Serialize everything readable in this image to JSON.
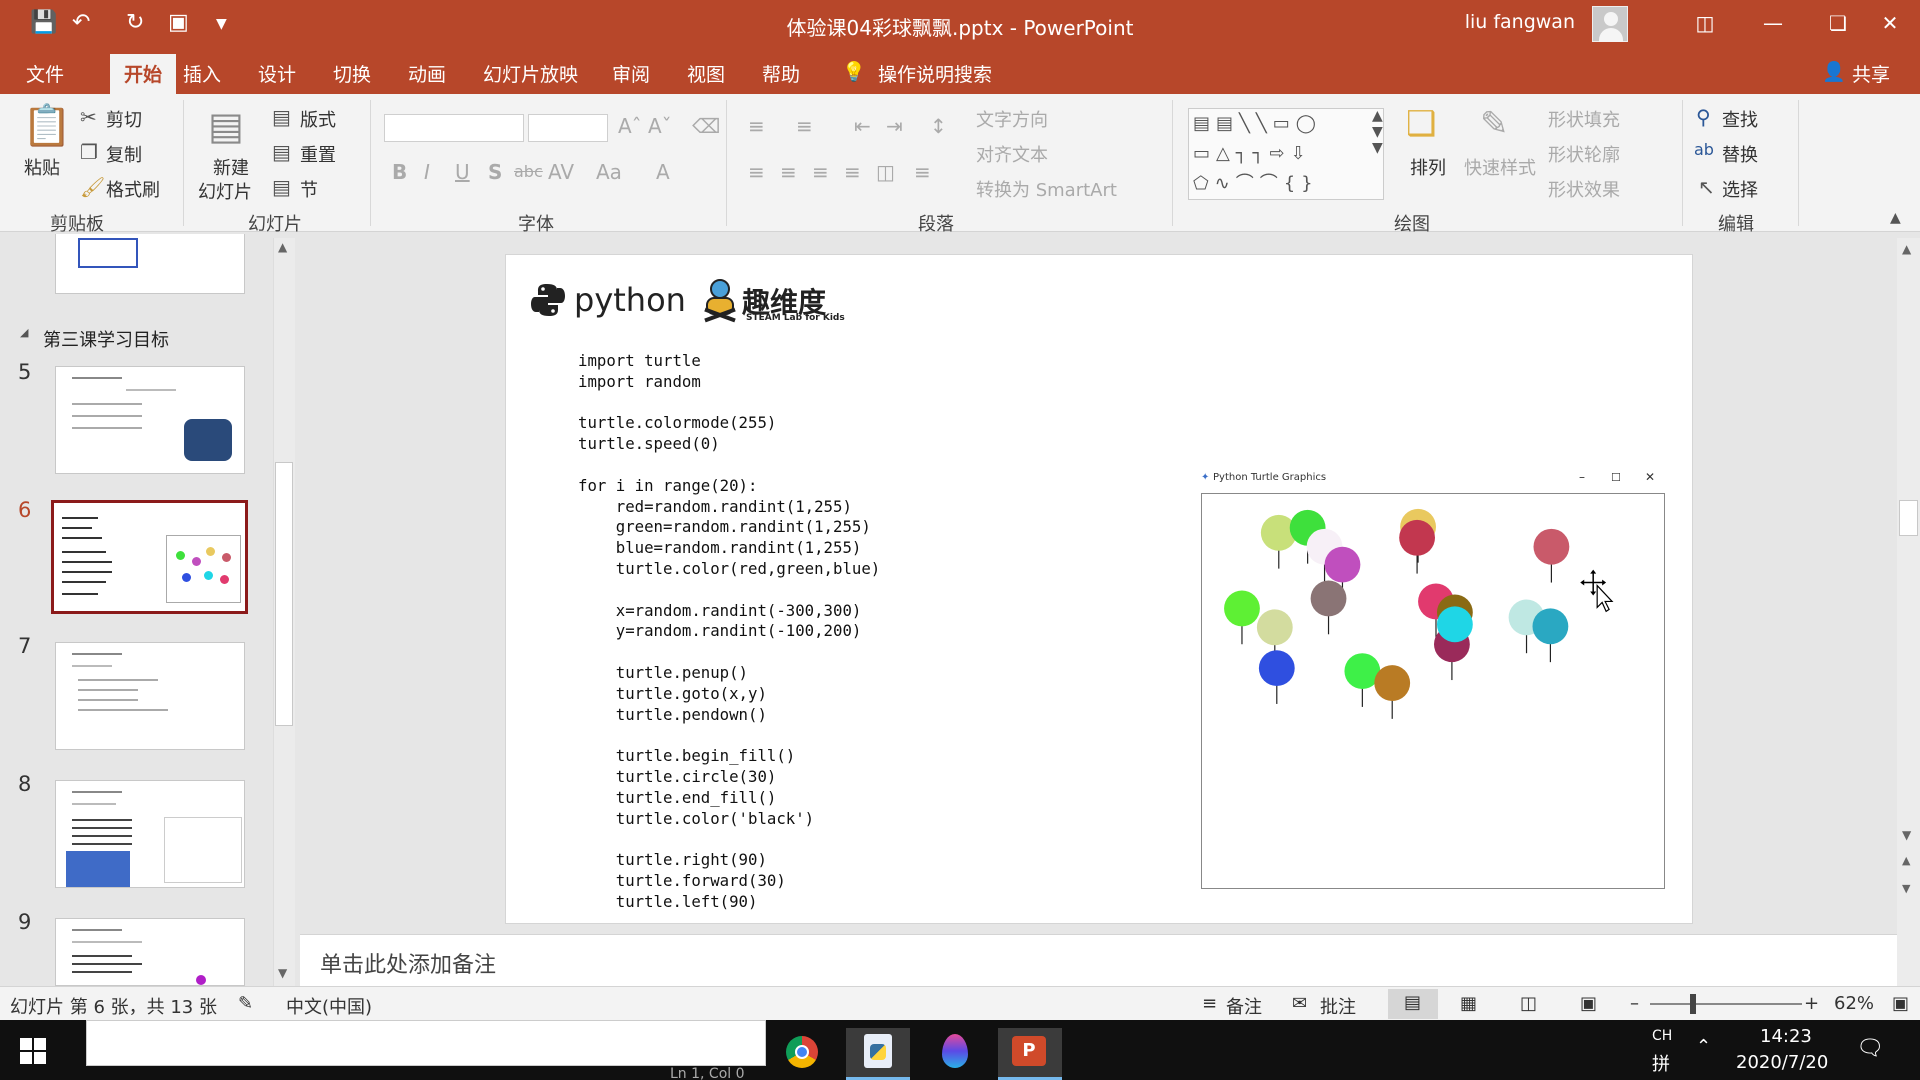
{
  "window": {
    "title": "体验课04彩球飘飘.pptx  -  PowerPoint",
    "user": "liu fangwan"
  },
  "menu": {
    "tabs": [
      "文件",
      "开始",
      "插入",
      "设计",
      "切换",
      "动画",
      "幻灯片放映",
      "审阅",
      "视图",
      "帮助"
    ],
    "active_tab": "开始",
    "search": "操作说明搜索",
    "share": "共享"
  },
  "ribbon": {
    "clipboard": {
      "paste": "粘贴",
      "cut": "剪切",
      "copy": "复制",
      "format_painter": "格式刷",
      "label": "剪贴板"
    },
    "slides": {
      "new_slide_line1": "新建",
      "new_slide_line2": "幻灯片",
      "layout": "版式",
      "reset": "重置",
      "section": "节",
      "label": "幻灯片"
    },
    "font": {
      "label": "字体",
      "bold": "B",
      "italic": "I",
      "underline": "U",
      "shadow": "S",
      "strike": "abc",
      "spacing": "AV",
      "case": "Aa",
      "color": "A"
    },
    "paragraph": {
      "label": "段落",
      "text_direction": "文字方向",
      "align_text": "对齐文本",
      "smartart": "转换为 SmartArt"
    },
    "drawing": {
      "arrange": "排列",
      "quick_styles": "快速样式",
      "fill": "形状填充",
      "outline": "形状轮廓",
      "effects": "形状效果",
      "label": "绘图"
    },
    "editing": {
      "find": "查找",
      "replace": "替换",
      "select": "选择",
      "label": "编辑"
    }
  },
  "thumbnails": {
    "section_title": "第三课学习目标",
    "slides": [
      {
        "number": "5"
      },
      {
        "number": "6",
        "selected": true
      },
      {
        "number": "7"
      },
      {
        "number": "8"
      },
      {
        "number": "9"
      }
    ]
  },
  "slide": {
    "logo_python": "python",
    "logo_brand": "趣维度",
    "logo_sub": "STEAM Lab for Kids",
    "code_lines": [
      "import turtle",
      "import random",
      "",
      "turtle.colormode(255)",
      "turtle.speed(0)",
      "",
      "for i in range(20):",
      "    red=random.randint(1,255)",
      "    green=random.randint(1,255)",
      "    blue=random.randint(1,255)",
      "    turtle.color(red,green,blue)",
      "",
      "    x=random.randint(-300,300)",
      "    y=random.randint(-100,200)",
      "",
      "    turtle.penup()",
      "    turtle.goto(x,y)",
      "    turtle.pendown()",
      "",
      "    turtle.begin_fill()",
      "    turtle.circle(30)",
      "    turtle.end_fill()",
      "    turtle.color('black')",
      "",
      "    turtle.right(90)",
      "    turtle.forward(30)",
      "    turtle.left(90)"
    ],
    "turtle_window_title": "Python Turtle Graphics",
    "balloon_colors": [
      "#c8e07a",
      "#3ee03c",
      "#f7f0f7",
      "#c04fbe",
      "#8a7475",
      "#e9c95f",
      "#c2374f",
      "#c95a6a",
      "#5ef034",
      "#d3dc9f",
      "#2f4fe0",
      "#3ef048",
      "#b97b24",
      "#e13a6e",
      "#8a6a14",
      "#9a2a5a",
      "#1fd6e6",
      "#bfe8e3",
      "#2aa8c2"
    ]
  },
  "notes": {
    "placeholder": "单击此处添加备注"
  },
  "status": {
    "slide_info": "幻灯片 第 6 张，共 13 张",
    "language": "中文(中国)",
    "notes": "备注",
    "comments": "批注",
    "zoom": "62%"
  },
  "taskbar": {
    "ime": "CH",
    "ime2": "拼",
    "time": "14:23",
    "date": "2020/7/20",
    "hidden_text": "Ln 1, Col 0"
  }
}
